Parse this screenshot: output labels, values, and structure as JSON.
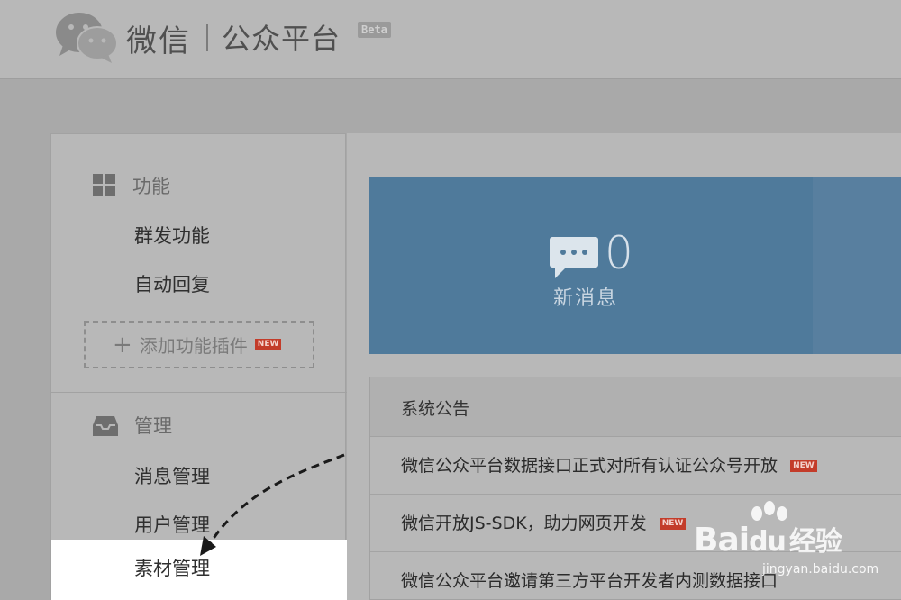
{
  "header": {
    "logo_text": "微信",
    "logo_sub": "公众平台",
    "beta": "Beta"
  },
  "sidebar": {
    "sections": [
      {
        "title": "功能",
        "icon": "grid-icon",
        "items": [
          "群发功能",
          "自动回复"
        ],
        "add_plugin": {
          "label": "添加功能插件",
          "badge": "NEW"
        }
      },
      {
        "title": "管理",
        "icon": "inbox-icon",
        "items": [
          "消息管理",
          "用户管理",
          "素材管理"
        ]
      }
    ],
    "active_item": "素材管理"
  },
  "stats": {
    "new_messages": {
      "value": "0",
      "label": "新消息",
      "icon": "chat-bubble-icon"
    }
  },
  "notices": {
    "title": "系统公告",
    "items": [
      {
        "text": "微信公众平台数据接口正式对所有认证公众号开放",
        "badge": "NEW"
      },
      {
        "text": "微信开放JS-SDK，助力网页开发",
        "badge": "NEW"
      },
      {
        "text": "微信公众平台邀请第三方平台开发者内测数据接口",
        "badge": ""
      }
    ]
  },
  "watermark": {
    "brand": "Bai",
    "brand_suffix": "du",
    "product": "经验",
    "url": "jingyan.baidu.com"
  },
  "colors": {
    "stat_tile": "#4f7a9b",
    "new_badge": "#c33c2a",
    "overlay_bg": "#a9a9a9"
  }
}
